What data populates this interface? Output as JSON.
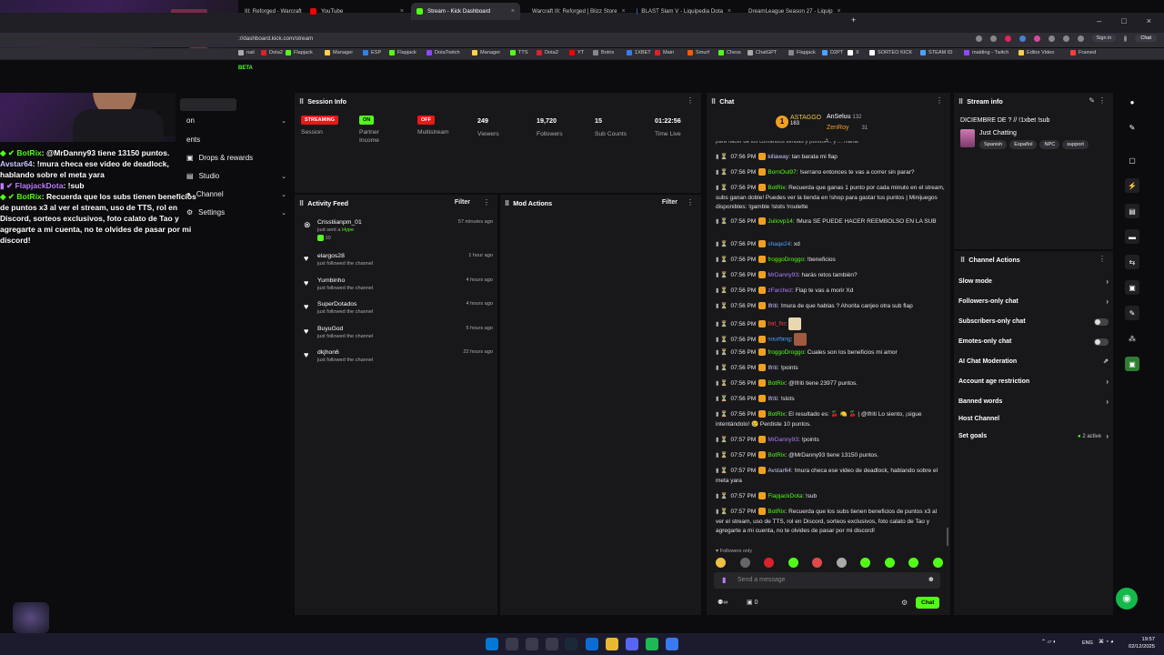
{
  "browser": {
    "tabs": [
      {
        "label": "III: Reforged - Warcraft",
        "color": "#4a6fb0"
      },
      {
        "label": "YouTube",
        "color": "#ff0000"
      },
      {
        "label": "Stream - Kick Dashboard",
        "color": "#53fc18"
      },
      {
        "label": "Warcraft III: Reforged | Blizz Store",
        "color": "#d8232a"
      },
      {
        "label": "BLAST Slam V - Liquipedia Dota",
        "color": "#3b5998"
      },
      {
        "label": "DreamLeague Season 27 - Liquip",
        "color": "#3b5998"
      }
    ],
    "new_tab": "+",
    "url": "://dashboard.kick.com/stream",
    "sign_in": "Sign in",
    "chat_button": "Chat",
    "bookmarks": [
      "nail",
      "Dota2",
      "Flapjack",
      "Manager",
      "ESP",
      "Flapjack",
      "DotaTwitch",
      "Manager",
      "TTS",
      "Dota2",
      "YT",
      "Botrix",
      "1XBET",
      "Main",
      "Smurf",
      "Chess",
      "ChatGPT",
      "Flapjack",
      "D2PT",
      "X",
      "SORTEO KICK",
      "STEAM ID",
      "malding - Twitch",
      "Editor Video",
      "Framed"
    ]
  },
  "kick": {
    "logo": "BETA"
  },
  "leftnav": {
    "items": [
      {
        "label": "on",
        "chevron": true
      },
      {
        "label": "ents",
        "chevron": false
      },
      {
        "label": "Drops & rewards",
        "chevron": false
      },
      {
        "label": "Studio",
        "chevron": true
      },
      {
        "label": "Channel",
        "chevron": true
      },
      {
        "label": "Settings",
        "chevron": true
      }
    ]
  },
  "session": {
    "title": "Session Info",
    "badges": [
      {
        "badge": "STREAMING",
        "label": "Session",
        "color": "#e91916"
      },
      {
        "badge": "ON",
        "label": "Partner Income",
        "color": "#53fc18"
      },
      {
        "badge": "OFF",
        "label": "Multistream",
        "color": "#e91916"
      }
    ],
    "stats": [
      {
        "value": "249",
        "label": "Viewers"
      },
      {
        "value": "19,720",
        "label": "Followers"
      },
      {
        "value": "15",
        "label": "Sub Counts"
      },
      {
        "value": "01:22:56",
        "label": "Time Live"
      }
    ]
  },
  "activity": {
    "title": "Activity Feed",
    "filter": "Filter",
    "items": [
      {
        "name": "Crisstiianpm_01",
        "sub": "just sent a",
        "extra": "Hype",
        "count": "10",
        "time": "57 minutes ago"
      },
      {
        "name": "elargos28",
        "sub": "just followed the channel",
        "time": "1 hour ago"
      },
      {
        "name": "Yumbinho",
        "sub": "just followed the channel",
        "time": "4 hours ago"
      },
      {
        "name": "SuperDotados",
        "sub": "just followed the channel",
        "time": "4 hours ago"
      },
      {
        "name": "BuyuGod",
        "sub": "just followed the channel",
        "time": "5 hours ago"
      },
      {
        "name": "dkjhon6",
        "sub": "just followed the channel",
        "time": "22 hours ago"
      }
    ]
  },
  "mod": {
    "title": "Mod Actions",
    "filter": "Filter"
  },
  "chat": {
    "title": "Chat",
    "leaderboard": [
      {
        "name": "ASTAGGO",
        "count": "163"
      },
      {
        "name": "AnSeluu",
        "count": "132"
      },
      {
        "name": "ZenRoy",
        "count": "31"
      }
    ],
    "cut_line": "para hacer de los comandos tiendas y puntos ... y ... mana!",
    "messages": [
      {
        "time": "07:56 PM",
        "user": "killaway",
        "color": "#c9c9ff",
        "text": "tan barata mi flap"
      },
      {
        "time": "07:56 PM",
        "user": "BornOut97",
        "color": "#53fc18",
        "text": "!serrano entonces te vas a correr sin parar?"
      },
      {
        "time": "07:56 PM",
        "user": "BotRix",
        "color": "#53fc18",
        "text": "Recuerda que ganas 1 punto por cada minuto en el stream, subs ganan doble! Puedes ver la tienda en !shop para gastar tus puntos | Minijuegos disponibles: !gamble !slots !roulette"
      },
      {
        "time": "07:56 PM",
        "user": "Juliovp14",
        "color": "#53fc18",
        "text": "!Mura SE PUEDE HACER REEMBOLSO EN LA SUB"
      },
      {
        "time": "07:56 PM",
        "user": "shaqe24",
        "color": "#4aa3ff",
        "text": "xd"
      },
      {
        "time": "07:56 PM",
        "user": "froggoDroggo",
        "color": "#53fc18",
        "text": "!beneficios"
      },
      {
        "time": "07:56 PM",
        "user": "MrDanny93",
        "color": "#b07cff",
        "text": "harás retos también?"
      },
      {
        "time": "07:56 PM",
        "user": "zFarchez",
        "color": "#b07cff",
        "text": "Flap te vas a morir Xd"
      },
      {
        "time": "07:56 PM",
        "user": "Ifriti",
        "color": "#c9c9ff",
        "text": "!mura de que hablas ? Ahorita canjeo otra sub flap"
      },
      {
        "time": "07:56 PM",
        "user": "bal_fio",
        "color": "#ff3c3c",
        "text": ""
      },
      {
        "time": "07:56 PM",
        "user": "sourfang",
        "color": "#4aa3ff",
        "text": ""
      },
      {
        "time": "07:56 PM",
        "user": "froggoDroggo",
        "color": "#53fc18",
        "text": "Cuales son los beneficios mi amor"
      },
      {
        "time": "07:56 PM",
        "user": "Ifriti",
        "color": "#c9c9ff",
        "text": "!points"
      },
      {
        "time": "07:56 PM",
        "user": "BotRix",
        "color": "#53fc18",
        "text": "@Ifriti tiene 23977 puntos."
      },
      {
        "time": "07:56 PM",
        "user": "Ifriti",
        "color": "#c9c9ff",
        "text": "!slots"
      },
      {
        "time": "07:56 PM",
        "user": "BotRix",
        "color": "#53fc18",
        "text": "El resultado es: 🍒 🍋 🍒 | @Ifriti Lo siento, ¡sigue intentándolo! 😢 Perdiste 10 puntos."
      },
      {
        "time": "07:57 PM",
        "user": "MrDanny93",
        "color": "#b07cff",
        "text": "!points"
      },
      {
        "time": "07:57 PM",
        "user": "BotRix",
        "color": "#53fc18",
        "text": "@MrDanny93 tiene 13150 puntos."
      },
      {
        "time": "07:57 PM",
        "user": "Avstar64",
        "color": "#c9c9ff",
        "text": "!mura checa ese video de deadlock, hablando sobre el meta yara"
      },
      {
        "time": "07:57 PM",
        "user": "FlapjackDota",
        "color": "#53fc18",
        "text": "!sub"
      },
      {
        "time": "07:57 PM",
        "user": "BotRix",
        "color": "#53fc18",
        "text": "Recuerda que los subs tienen beneficios de puntos x3 al ver el stream, uso de TTS, rol en Discord, sorteos exclusivos, foto calato de Tao y agregarte a mi cuenta, no te olvides de pasar por mi discord!"
      }
    ],
    "followers_only": "Followers only",
    "placeholder": "Send a message",
    "viewers_count": "0",
    "send": "Chat"
  },
  "streaminfo": {
    "title": "Stream info",
    "stream_title": "DICIEMBRE DE ? // !1xbet !sub",
    "category": "Just Chatting",
    "tags": [
      "Spanish",
      "Español",
      "NPC",
      "support"
    ]
  },
  "channel_actions": {
    "title": "Channel Actions",
    "items": [
      {
        "label": "Slow mode",
        "ctl": "chevron"
      },
      {
        "label": "Followers-only chat",
        "ctl": "chevron"
      },
      {
        "label": "Subscribers-only chat",
        "ctl": "toggle"
      },
      {
        "label": "Emotes-only chat",
        "ctl": "toggle"
      },
      {
        "label": "AI Chat Moderation",
        "ctl": "external"
      },
      {
        "label": "Account age restriction",
        "ctl": "chevron"
      },
      {
        "label": "Banned words",
        "ctl": "chevron"
      },
      {
        "label": "Host Channel",
        "ctl": "none"
      },
      {
        "label": "Set goals",
        "ctl": "chevron",
        "extra": "2 active"
      }
    ]
  },
  "overlay": {
    "lines": [
      {
        "user": "BotRix",
        "text": ": @MrDanny93 tiene 13150 puntos."
      },
      {
        "user": "Avstar64",
        "text": ": !mura checa ese video de deadlock, hablando sobre el meta yara"
      },
      {
        "user": "FlapjackDota",
        "text": ": !sub"
      },
      {
        "user": "BotRix",
        "text": ": Recuerda que los subs tienen beneficios de puntos x3 al ver el stream, uso de TTS, rol en Discord, sorteos exclusivos, foto calato de Tao y agregarte a mi cuenta, no te olvides de pasar por mi discord!"
      }
    ]
  },
  "taskbar": {
    "lang": "ENG",
    "time": "19:57",
    "date": "02/12/2025"
  }
}
